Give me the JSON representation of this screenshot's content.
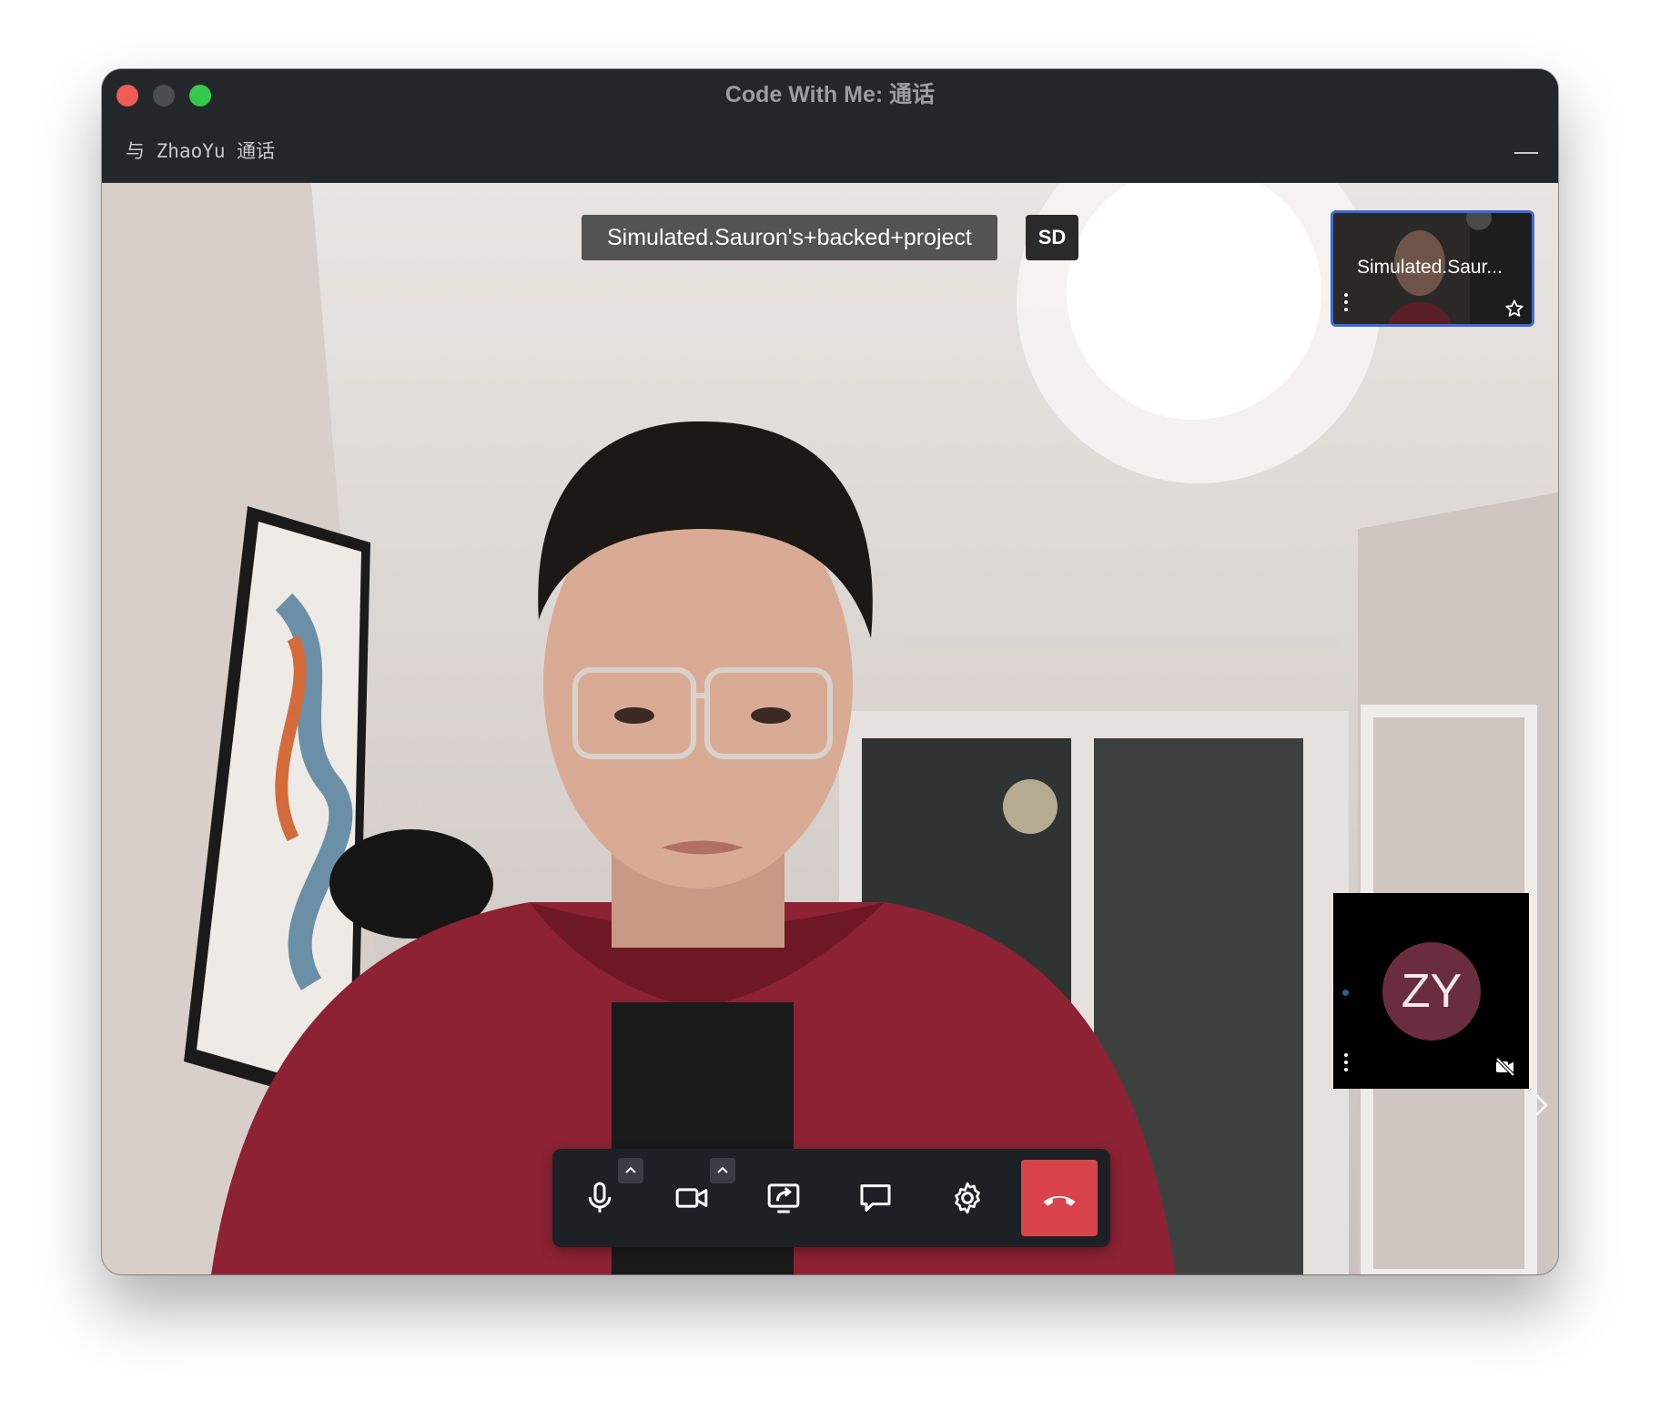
{
  "window": {
    "title": "Code With Me: 通话",
    "subtitle": "与 ZhaoYu 通话"
  },
  "main_video": {
    "participant_label": "Simulated.Sauron's+backed+project",
    "quality_badge": "SD"
  },
  "tiles": {
    "self": {
      "name": "Simulated.Saur..."
    },
    "peer": {
      "initials": "ZY",
      "avatar_color": "#6a2d3e"
    }
  },
  "toolbar": {
    "items": [
      {
        "icon": "microphone-icon",
        "has_options": true
      },
      {
        "icon": "camera-icon",
        "has_options": true
      },
      {
        "icon": "screen-share-icon",
        "has_options": false
      },
      {
        "icon": "chat-icon",
        "has_options": false
      },
      {
        "icon": "gear-icon",
        "has_options": false
      },
      {
        "icon": "hang-up-icon",
        "has_options": false
      }
    ],
    "hangup_color": "#d9444c"
  },
  "colors": {
    "titlebar_bg": "#23262b",
    "tile_highlight": "#3d6bd8",
    "close": "#ee5c54",
    "maximize": "#35c84b"
  }
}
